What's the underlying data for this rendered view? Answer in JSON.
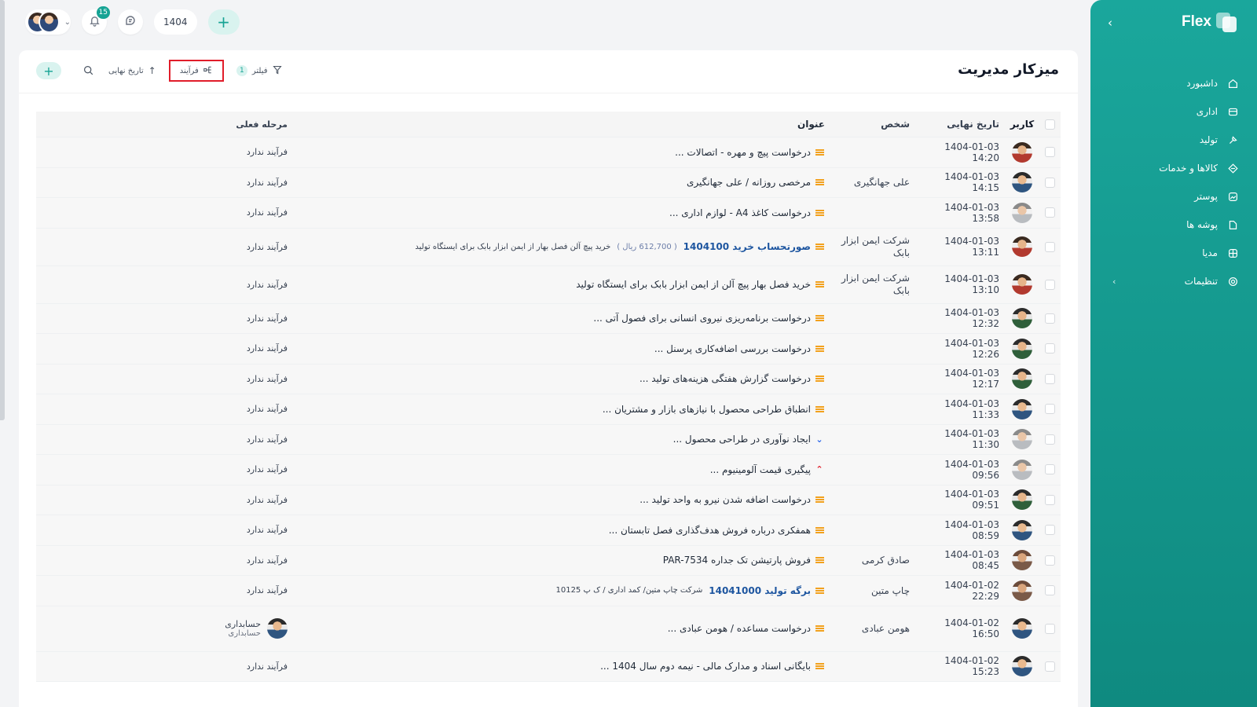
{
  "sidebar": {
    "brand": "Flex",
    "items": [
      {
        "label": "داشبورد",
        "icon": "home-icon"
      },
      {
        "label": "اداری",
        "icon": "office-icon"
      },
      {
        "label": "تولید",
        "icon": "production-icon"
      },
      {
        "label": "کالاها و خدمات",
        "icon": "products-icon"
      },
      {
        "label": "پوستر",
        "icon": "poster-icon"
      },
      {
        "label": "پوشه ها",
        "icon": "folder-icon"
      },
      {
        "label": "مدیا",
        "icon": "media-icon"
      },
      {
        "label": "تنظیمات",
        "icon": "settings-icon"
      }
    ]
  },
  "topbar": {
    "notifications_count": "15",
    "year": "1404",
    "add_label": "+"
  },
  "page": {
    "title": "میزکار مدیریت"
  },
  "toolbar": {
    "add_label": "+",
    "sort_label": "تاریخ نهایی",
    "process_label": "فرآیند",
    "filter_label": "فیلتر",
    "filter_count": "1"
  },
  "table": {
    "headers": {
      "user": "کاربر",
      "date": "تاریخ نهایی",
      "person": "شخص",
      "title": "عنوان",
      "stage": "مرحله فعلی"
    },
    "rows": [
      {
        "date": "1404-01-03 14:20",
        "person": "",
        "title": "درخواست پیچ و مهره - اتصالات ...",
        "priority": "medium",
        "stage": "فرآیند ندارد",
        "avatar": "red"
      },
      {
        "date": "1404-01-03 14:15",
        "person": "علی جهانگیری",
        "title": "مرخصی روزانه / علی جهانگیری",
        "priority": "medium",
        "stage": "فرآیند ندارد",
        "avatar": "blue"
      },
      {
        "date": "1404-01-03 13:58",
        "person": "",
        "title": "درخواست کاغذ A4 - لوازم اداری ...",
        "priority": "medium",
        "stage": "فرآیند ندارد",
        "avatar": "grey"
      },
      {
        "date": "1404-01-03 13:11",
        "person": "شرکت ایمن ابزار بابک",
        "title_link": "صورتحساب خرید 1404100",
        "title_amount": "( 612,700 ریال )",
        "title_rest": "خرید پیچ آلن فصل بهار از ایمن ابزار بابک برای ایستگاه تولید",
        "priority": "medium",
        "stage": "فرآیند ندارد",
        "avatar": "red"
      },
      {
        "date": "1404-01-03 13:10",
        "person": "شرکت ایمن ابزار بابک",
        "title": "خرید فصل بهار پیچ آلن از ایمن ابزار بابک برای ایستگاه تولید",
        "priority": "medium",
        "stage": "فرآیند ندارد",
        "avatar": "red"
      },
      {
        "date": "1404-01-03 12:32",
        "person": "",
        "title": "درخواست برنامه‌ریزی نیروی انسانی برای فصول آتی ...",
        "priority": "medium",
        "stage": "فرآیند ندارد",
        "avatar": "green"
      },
      {
        "date": "1404-01-03 12:26",
        "person": "",
        "title": "درخواست بررسی اضافه‌کاری پرسنل ...",
        "priority": "medium",
        "stage": "فرآیند ندارد",
        "avatar": "green"
      },
      {
        "date": "1404-01-03 12:17",
        "person": "",
        "title": "درخواست گزارش هفتگی هزینه‌های تولید ...",
        "priority": "medium",
        "stage": "فرآیند ندارد",
        "avatar": "green"
      },
      {
        "date": "1404-01-03 11:33",
        "person": "",
        "title": "انطباق طراحی محصول با نیازهای بازار و مشتریان ...",
        "priority": "medium",
        "stage": "فرآیند ندارد",
        "avatar": "blue"
      },
      {
        "date": "1404-01-03 11:30",
        "person": "",
        "title": "ایجاد نوآوری در طراحی محصول ...",
        "priority": "low",
        "stage": "فرآیند ندارد",
        "avatar": "grey"
      },
      {
        "date": "1404-01-03 09:56",
        "person": "",
        "title": "پیگیری قیمت آلومینیوم ...",
        "priority": "high",
        "stage": "فرآیند ندارد",
        "avatar": "grey"
      },
      {
        "date": "1404-01-03 09:51",
        "person": "",
        "title": "درخواست اضافه شدن نیرو به واحد تولید ...",
        "priority": "medium",
        "stage": "فرآیند ندارد",
        "avatar": "green"
      },
      {
        "date": "1404-01-03 08:59",
        "person": "",
        "title": "همفکری درباره فروش هدف‌گذاری فصل تابستان ...",
        "priority": "medium",
        "stage": "فرآیند ندارد",
        "avatar": "blue"
      },
      {
        "date": "1404-01-03 08:45",
        "person": "صادق کرمی",
        "title": "فروش پارتیشن تک جداره PAR-7534",
        "priority": "medium",
        "stage": "فرآیند ندارد",
        "avatar": "brown"
      },
      {
        "date": "1404-01-02 22:29",
        "person": "چاپ متین",
        "title_link": "برگه تولید 14041000",
        "title_rest": "شرکت چاپ متین/ کمد اداری / ک پ 10125",
        "priority": "medium",
        "stage": "فرآیند ندارد",
        "avatar": "brown"
      },
      {
        "date": "1404-01-02 16:50",
        "person": "هومن عبادی",
        "title": "درخواست مساعده / هومن عبادی ...",
        "priority": "medium",
        "stage_name": "حسابداری",
        "stage_sub": "حسابداری",
        "avatar": "blue"
      },
      {
        "date": "1404-01-02 15:23",
        "person": "",
        "title": "بایگانی اسناد و مدارک مالی - نیمه دوم سال 1404 ...",
        "priority": "medium",
        "stage": "فرآیند ندارد",
        "avatar": "blue"
      }
    ]
  },
  "colors": {
    "accent": "#16a394",
    "sidebar_top": "#1aa79c",
    "sidebar_bottom": "#0f8a80",
    "priority_medium": "#f2a11e",
    "priority_low": "#2563eb",
    "priority_high": "#e11d2a",
    "highlight_border": "#e11d2a"
  }
}
